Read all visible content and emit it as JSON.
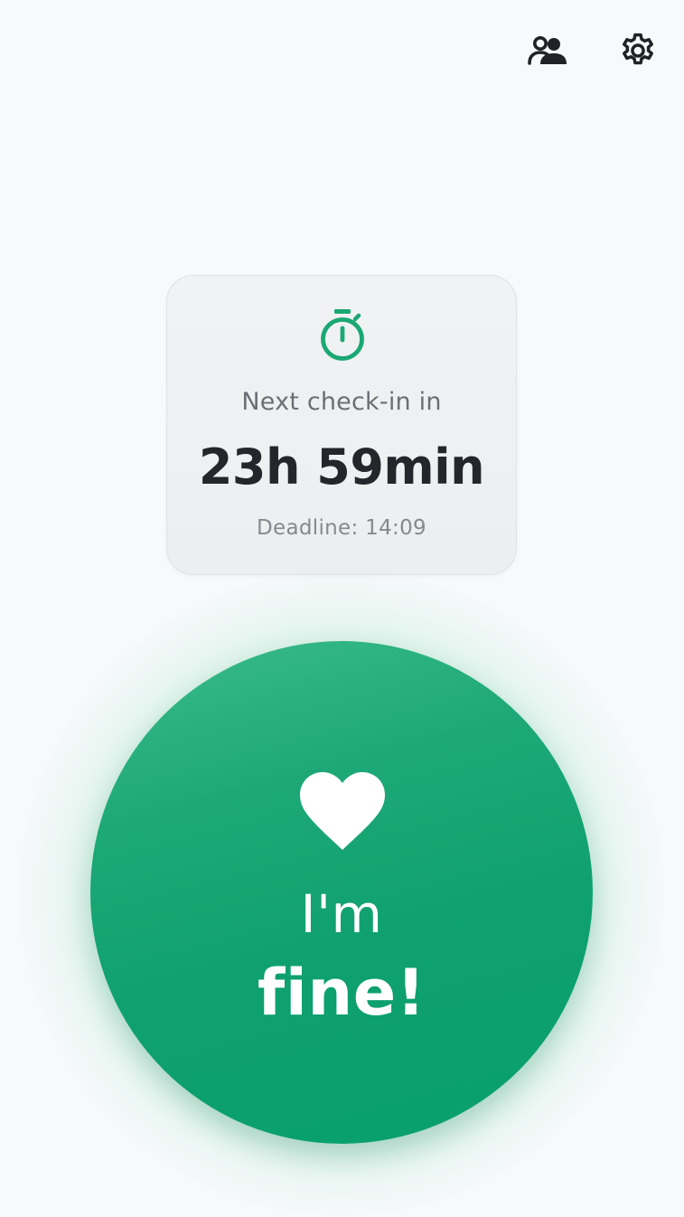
{
  "header": {
    "contacts_icon": "contacts-icon",
    "settings_icon": "gear-icon"
  },
  "status_card": {
    "icon": "stopwatch-icon",
    "label": "Next check-in in",
    "countdown": "23h 59min",
    "deadline": "Deadline: 14:09"
  },
  "checkin_button": {
    "icon": "heart-icon",
    "line1": "I'm",
    "line2": "fine!"
  },
  "colors": {
    "accent": "#10a572",
    "background": "#f8f9fb",
    "icon_dark": "#1f2226"
  }
}
